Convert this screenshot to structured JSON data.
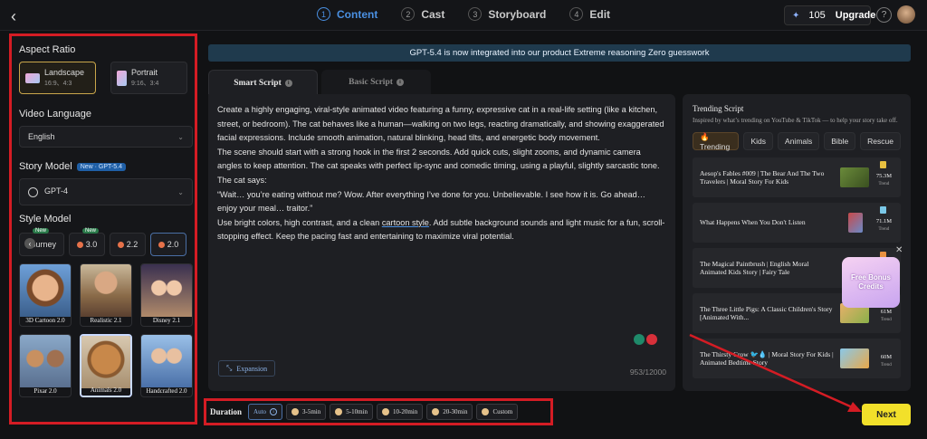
{
  "header": {
    "steps": [
      {
        "num": "1",
        "label": "Content"
      },
      {
        "num": "2",
        "label": "Cast"
      },
      {
        "num": "3",
        "label": "Storyboard"
      },
      {
        "num": "4",
        "label": "Edit"
      }
    ],
    "credits": "105",
    "upgrade": "Upgrade",
    "help": "?"
  },
  "sidebar": {
    "aspect_title": "Aspect Ratio",
    "aspect_options": [
      {
        "name": "Landscape",
        "sub": "16:9、4:3"
      },
      {
        "name": "Portrait",
        "sub": "9:16、3:4"
      }
    ],
    "language_title": "Video Language",
    "language_value": "English",
    "story_title": "Story Model",
    "story_badge": "New · GPT-5.4",
    "story_value": "GPT-4",
    "style_title": "Style Model",
    "style_tabs": [
      {
        "label": "Journey",
        "badge": "New"
      },
      {
        "label": "3.0",
        "badge": "New"
      },
      {
        "label": "2.2",
        "badge": ""
      },
      {
        "label": "2.0",
        "badge": ""
      }
    ],
    "styles": [
      {
        "label": "3D Cartoon 2.0"
      },
      {
        "label": "Realistic 2.1"
      },
      {
        "label": "Disney 2.1"
      },
      {
        "label": "Pixar 2.0"
      },
      {
        "label": "Animals 2.0"
      },
      {
        "label": "Handcrafted 2.0"
      }
    ]
  },
  "banner": "GPT-5.4 is now integrated into our product Extreme reasoning Zero guesswork",
  "tabs": {
    "smart": "Smart Script",
    "basic": "Basic Script"
  },
  "editor": {
    "p1": "Create a highly engaging, viral-style animated video featuring a funny, expressive cat in a real-life setting (like a kitchen, street, or bedroom). The cat behaves like a human—walking on two legs, reacting dramatically, and showing exaggerated facial expressions. Include smooth animation, natural blinking, head tilts, and energetic body movement.",
    "p2": "The scene should start with a strong hook in the first 2 seconds. Add quick cuts, slight zooms, and dynamic camera angles to keep attention. The cat speaks with perfect lip-sync and comedic timing, using a playful, slightly sarcastic tone.",
    "p3": "The cat says:",
    "p4": "“Wait… you’re eating without me? Wow. After everything I’ve done for you. Unbelievable. I see how it is. Go ahead… enjoy your meal… traitor.”",
    "p5a": "Use bright colors, high contrast, and a clean ",
    "p5link": "cartoon style",
    "p5b": ". Add subtle background sounds and light music for a fun, scroll-stopping effect. Keep the pacing fast and entertaining to maximize viral potential.",
    "expansion": "Expansion",
    "counter": "953/12000"
  },
  "trending": {
    "title": "Trending Script",
    "subtitle": "Inspired by what’s trending on YouTube & TikTok — to help your story take off.",
    "categories": [
      "🔥Trending",
      "Kids",
      "Animals",
      "Bible",
      "Rescue"
    ],
    "items": [
      {
        "title": "Aesop's Fables #009 | The Bear And The Two Travelers | Moral Story For Kids",
        "value": "75.3M",
        "sub": "Trend"
      },
      {
        "title": "What Happens When You Don't Listen",
        "value": "71.1M",
        "sub": "Trend"
      },
      {
        "title": "The Magical Paintbrush | English Moral Animated Kids Story | Fairy Tale",
        "value": "",
        "sub": ""
      },
      {
        "title": "The Three Little Pigs: A Classic Children's Story [Animated With...",
        "value": "61M",
        "sub": "Trend"
      },
      {
        "title": "The Thirsty Crow 🐦💧 | Moral Story For Kids | Animated Bedtime Story",
        "value": "60M",
        "sub": "Trend"
      }
    ],
    "bonus": "Free Bonus Credits"
  },
  "duration": {
    "label": "Duration",
    "options": [
      "Auto",
      "3-5min",
      "5-10min",
      "10-20min",
      "20-30min",
      "Custom"
    ]
  },
  "next": "Next",
  "colors": {
    "accent": "#4a90e2",
    "highlight": "#d41c24",
    "next": "#f2e02a"
  }
}
